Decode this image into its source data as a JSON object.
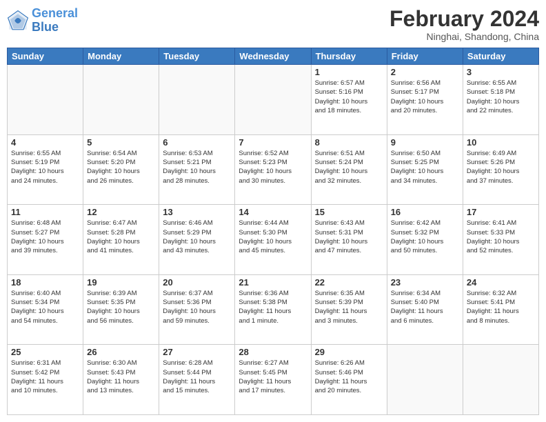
{
  "header": {
    "logo_line1": "General",
    "logo_line2": "Blue",
    "main_title": "February 2024",
    "subtitle": "Ninghai, Shandong, China"
  },
  "weekdays": [
    "Sunday",
    "Monday",
    "Tuesday",
    "Wednesday",
    "Thursday",
    "Friday",
    "Saturday"
  ],
  "weeks": [
    [
      {
        "day": "",
        "info": ""
      },
      {
        "day": "",
        "info": ""
      },
      {
        "day": "",
        "info": ""
      },
      {
        "day": "",
        "info": ""
      },
      {
        "day": "1",
        "info": "Sunrise: 6:57 AM\nSunset: 5:16 PM\nDaylight: 10 hours\nand 18 minutes."
      },
      {
        "day": "2",
        "info": "Sunrise: 6:56 AM\nSunset: 5:17 PM\nDaylight: 10 hours\nand 20 minutes."
      },
      {
        "day": "3",
        "info": "Sunrise: 6:55 AM\nSunset: 5:18 PM\nDaylight: 10 hours\nand 22 minutes."
      }
    ],
    [
      {
        "day": "4",
        "info": "Sunrise: 6:55 AM\nSunset: 5:19 PM\nDaylight: 10 hours\nand 24 minutes."
      },
      {
        "day": "5",
        "info": "Sunrise: 6:54 AM\nSunset: 5:20 PM\nDaylight: 10 hours\nand 26 minutes."
      },
      {
        "day": "6",
        "info": "Sunrise: 6:53 AM\nSunset: 5:21 PM\nDaylight: 10 hours\nand 28 minutes."
      },
      {
        "day": "7",
        "info": "Sunrise: 6:52 AM\nSunset: 5:23 PM\nDaylight: 10 hours\nand 30 minutes."
      },
      {
        "day": "8",
        "info": "Sunrise: 6:51 AM\nSunset: 5:24 PM\nDaylight: 10 hours\nand 32 minutes."
      },
      {
        "day": "9",
        "info": "Sunrise: 6:50 AM\nSunset: 5:25 PM\nDaylight: 10 hours\nand 34 minutes."
      },
      {
        "day": "10",
        "info": "Sunrise: 6:49 AM\nSunset: 5:26 PM\nDaylight: 10 hours\nand 37 minutes."
      }
    ],
    [
      {
        "day": "11",
        "info": "Sunrise: 6:48 AM\nSunset: 5:27 PM\nDaylight: 10 hours\nand 39 minutes."
      },
      {
        "day": "12",
        "info": "Sunrise: 6:47 AM\nSunset: 5:28 PM\nDaylight: 10 hours\nand 41 minutes."
      },
      {
        "day": "13",
        "info": "Sunrise: 6:46 AM\nSunset: 5:29 PM\nDaylight: 10 hours\nand 43 minutes."
      },
      {
        "day": "14",
        "info": "Sunrise: 6:44 AM\nSunset: 5:30 PM\nDaylight: 10 hours\nand 45 minutes."
      },
      {
        "day": "15",
        "info": "Sunrise: 6:43 AM\nSunset: 5:31 PM\nDaylight: 10 hours\nand 47 minutes."
      },
      {
        "day": "16",
        "info": "Sunrise: 6:42 AM\nSunset: 5:32 PM\nDaylight: 10 hours\nand 50 minutes."
      },
      {
        "day": "17",
        "info": "Sunrise: 6:41 AM\nSunset: 5:33 PM\nDaylight: 10 hours\nand 52 minutes."
      }
    ],
    [
      {
        "day": "18",
        "info": "Sunrise: 6:40 AM\nSunset: 5:34 PM\nDaylight: 10 hours\nand 54 minutes."
      },
      {
        "day": "19",
        "info": "Sunrise: 6:39 AM\nSunset: 5:35 PM\nDaylight: 10 hours\nand 56 minutes."
      },
      {
        "day": "20",
        "info": "Sunrise: 6:37 AM\nSunset: 5:36 PM\nDaylight: 10 hours\nand 59 minutes."
      },
      {
        "day": "21",
        "info": "Sunrise: 6:36 AM\nSunset: 5:38 PM\nDaylight: 11 hours\nand 1 minute."
      },
      {
        "day": "22",
        "info": "Sunrise: 6:35 AM\nSunset: 5:39 PM\nDaylight: 11 hours\nand 3 minutes."
      },
      {
        "day": "23",
        "info": "Sunrise: 6:34 AM\nSunset: 5:40 PM\nDaylight: 11 hours\nand 6 minutes."
      },
      {
        "day": "24",
        "info": "Sunrise: 6:32 AM\nSunset: 5:41 PM\nDaylight: 11 hours\nand 8 minutes."
      }
    ],
    [
      {
        "day": "25",
        "info": "Sunrise: 6:31 AM\nSunset: 5:42 PM\nDaylight: 11 hours\nand 10 minutes."
      },
      {
        "day": "26",
        "info": "Sunrise: 6:30 AM\nSunset: 5:43 PM\nDaylight: 11 hours\nand 13 minutes."
      },
      {
        "day": "27",
        "info": "Sunrise: 6:28 AM\nSunset: 5:44 PM\nDaylight: 11 hours\nand 15 minutes."
      },
      {
        "day": "28",
        "info": "Sunrise: 6:27 AM\nSunset: 5:45 PM\nDaylight: 11 hours\nand 17 minutes."
      },
      {
        "day": "29",
        "info": "Sunrise: 6:26 AM\nSunset: 5:46 PM\nDaylight: 11 hours\nand 20 minutes."
      },
      {
        "day": "",
        "info": ""
      },
      {
        "day": "",
        "info": ""
      }
    ]
  ]
}
